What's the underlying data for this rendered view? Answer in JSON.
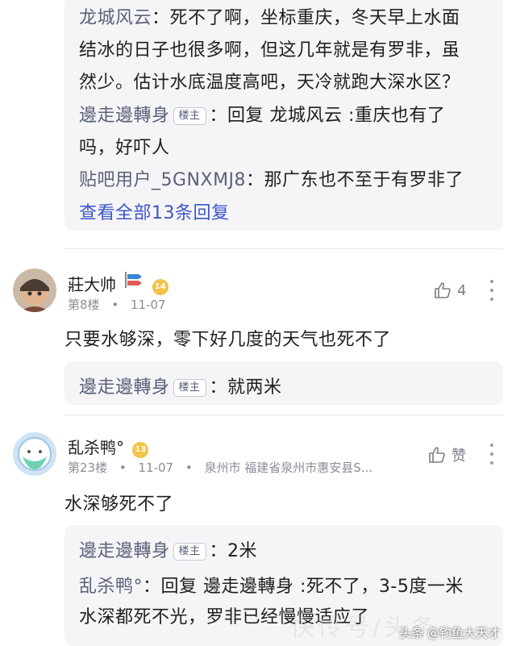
{
  "thread1": {
    "reply1": {
      "user": "龙城风云",
      "line1": "：死不了啊，坐标重庆，冬天早上水面",
      "line2": "结冰的日子也很多啊，但这几年就是有罗非，虽",
      "line3": "然少。估计水底温度高吧，天冷就跑大深水区？"
    },
    "reply2": {
      "user": "邊走邊轉身",
      "badge": "楼主",
      "line1": "：回复 龙城风云 :重庆也有了",
      "line2": "吗，好吓人"
    },
    "reply3": {
      "user": "贴吧用户_5GNXMJ8",
      "text": "：那广东也不至于有罗非了"
    },
    "view_all": "查看全部13条回复"
  },
  "post8": {
    "author": "莊大帅",
    "level": "14",
    "floor": "第8楼",
    "date": "11-07",
    "likes": "4",
    "content": "只要水够深，零下好几度的天气也死不了",
    "reply": {
      "user": "邊走邊轉身",
      "badge": "楼主",
      "text": "：就两米"
    }
  },
  "post23": {
    "author": "乱杀鸭°",
    "level": "13",
    "floor": "第23楼",
    "date": "11-07",
    "location": "泉州市 福建省泉州市惠安县S...",
    "like_label": "赞",
    "content": "水深够死不了",
    "reply1": {
      "user": "邊走邊轉身",
      "badge": "楼主",
      "text": "：2米"
    },
    "reply2": {
      "user": "乱杀鸭°",
      "line1": "：回复 邊走邊轉身 :死不了，3-5度一米",
      "line2": "水深都死不光，罗非已经慢慢适应了"
    }
  },
  "watermark": "头条 @钓鱼大天才",
  "watermark_faint": "快传号/头条"
}
